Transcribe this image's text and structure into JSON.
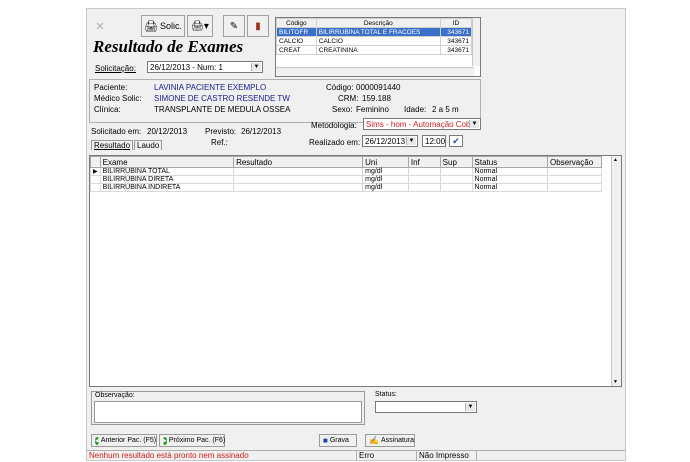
{
  "toolbar": {
    "solic_label": "Solic."
  },
  "title": "Resultado de Exames",
  "solicitacao": {
    "label": "Solicitação:",
    "value": "26/12/2013 - Num: 1"
  },
  "exam_list": {
    "headers": [
      "Código",
      "Descrição",
      "ID"
    ],
    "rows": [
      [
        "BILITOFR",
        "BILIRRUBINA TOTAL E FRACOES",
        "343671"
      ],
      [
        "CALCIO",
        "CALCIO",
        "343671"
      ],
      [
        "CREAT",
        "CREATININA",
        "343671"
      ]
    ]
  },
  "patient": {
    "paciente_label": "Paciente:",
    "paciente": "LAVINIA PACIENTE EXEMPLO",
    "medico_label": "Médico Solic:",
    "medico": "SIMONE DE CASTRO RESENDE TW",
    "clinica_label": "Clínica:",
    "clinica": "TRANSPLANTE DE MEDULA OSSEA",
    "codigo_label": "Código:",
    "codigo": "0000091440",
    "crm_label": "CRM:",
    "crm": "159.188",
    "sexo_label": "Sexo:",
    "sexo": "Feminino",
    "idade_label": "Idade:",
    "idade": "2 a 5 m"
  },
  "metodologia": {
    "label": "Metodologia:",
    "value": "Sims - hom - Automação Cob"
  },
  "dates": {
    "solicitado_label": "Solicitado em:",
    "solicitado": "20/12/2013",
    "previsto_label": "Previsto:",
    "previsto": "26/12/2013",
    "ref_label": "Ref.:",
    "realizado_label": "Realizado em:",
    "realizado": "26/12/2013",
    "hora": "12:00"
  },
  "tabs": [
    "Resultado",
    "Laudo"
  ],
  "results": {
    "headers": [
      "Exame",
      "Resultado",
      "Uni",
      "Inf",
      "Sup",
      "Status",
      "Observação"
    ],
    "rows": [
      [
        "BILIRRUBINA TOTAL",
        "",
        "mg/dl",
        "",
        "",
        "Normal",
        ""
      ],
      [
        "BILIRRUBINA DIRETA",
        "",
        "mg/dl",
        "",
        "",
        "Normal",
        ""
      ],
      [
        "BILIRRUBINA INDIRETA",
        "",
        "mg/dl",
        "",
        "",
        "Normal",
        ""
      ]
    ]
  },
  "observacao_label": "Observação:",
  "status_label": "Status:",
  "buttons": {
    "anterior": "Anterior Pac. (F5)",
    "proximo": "Próximo Pac. (F6)",
    "grava": "Grava",
    "assinatura": "Assinatura"
  },
  "statusbar": {
    "message": "Nenhum resultado está pronto nem assinado",
    "erro": "Erro",
    "impresso": "Não Impresso"
  },
  "colors": {
    "highlight": "#3a70c8",
    "status_msg": "#cc2020",
    "metodologia": "#cc2020"
  }
}
